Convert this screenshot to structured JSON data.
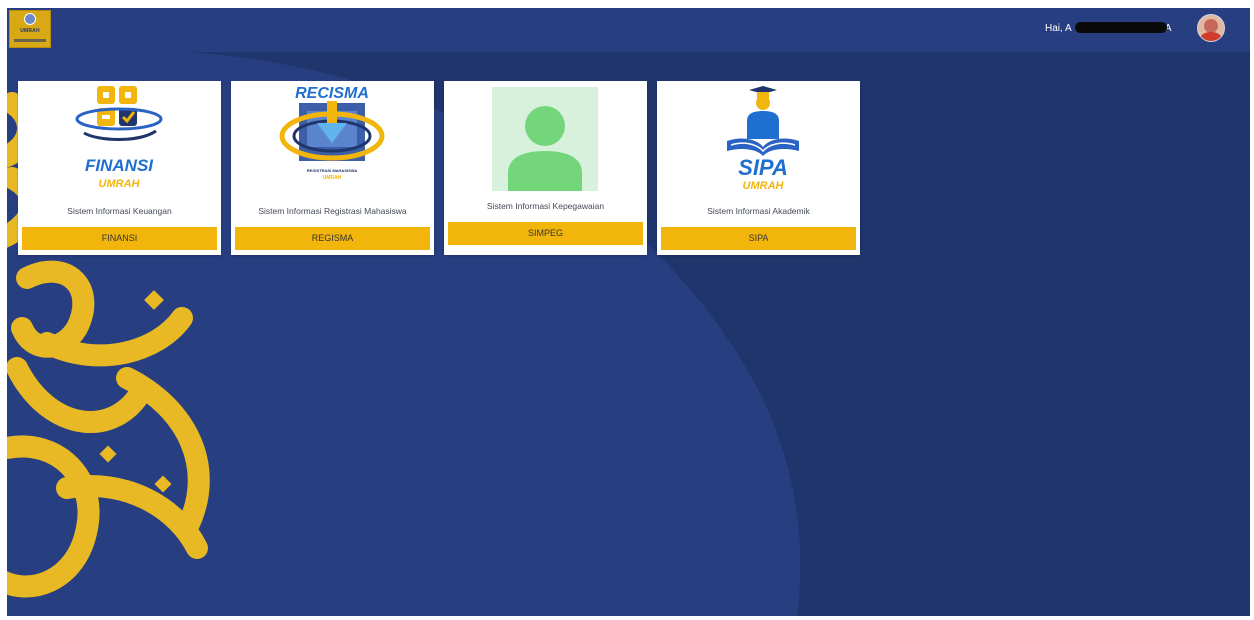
{
  "header": {
    "logo_text": "UMRAH",
    "greeting": "Hai, A",
    "greeting_suffix": "RA",
    "logo_icon": "university-emblem-icon",
    "avatar_icon": "user-avatar"
  },
  "apps": [
    {
      "logo_title": "FINANSI",
      "logo_sub": "UMRAH",
      "description": "Sistem Informasi Keuangan",
      "button_label": "FINANSI",
      "icon": "finance-app-icon"
    },
    {
      "logo_title": "RECISMA",
      "logo_tagline": "REGISTRASI MAHASISWA",
      "logo_sub": "UMRAH",
      "description": "Sistem Informasi Registrasi Mahasiswa",
      "button_label": "REGISMA",
      "icon": "registration-app-icon"
    },
    {
      "description": "Sistem Informasi Kepegawaian",
      "button_label": "SIMPEG",
      "icon": "user-placeholder-icon"
    },
    {
      "logo_title": "SIPA",
      "logo_sub": "UMRAH",
      "description": "Sistem Informasi Akademik",
      "button_label": "SIPA",
      "icon": "graduate-reading-icon"
    }
  ],
  "colors": {
    "background": "#1f356c",
    "topbar": "#273f80",
    "accent": "#f2b50c",
    "calligraphy": "#e8b925"
  }
}
